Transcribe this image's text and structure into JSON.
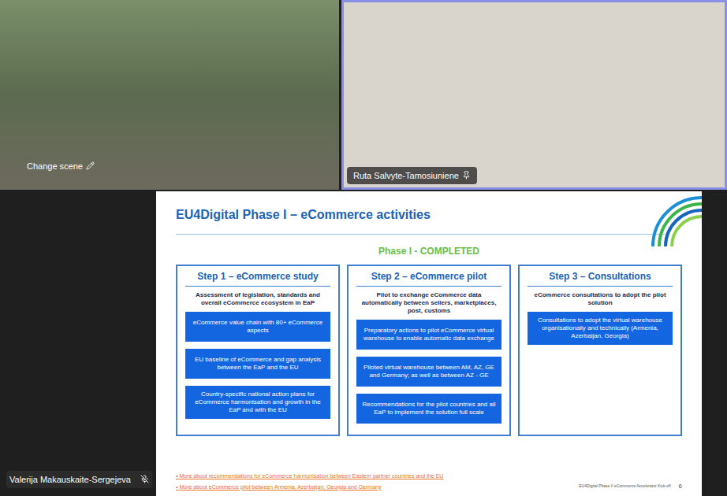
{
  "scene_tile": {
    "label": "Change scene"
  },
  "speaker_tile": {
    "name": "Ruta Salvyte-Tamosiuniene",
    "pinned": true,
    "selected": true
  },
  "presenter": {
    "name": "Valerija Makauskaite-Sergejeva",
    "muted": true
  },
  "slide": {
    "title": "EU4Digital Phase I – eCommerce activities",
    "status": "Phase I - COMPLETED",
    "steps": [
      {
        "title": "Step 1 – eCommerce study",
        "subtitle": "Assessment of legislation, standards and overall eCommerce ecosystem in EaP",
        "items": [
          "eCommerce value chain with 80+ eCommerce aspects",
          "EU baseline of eCommerce and gap analysis between the EaP and the EU",
          "Country-specific national action plans for eCommerce harmonisation and growth in the EaP and with the EU"
        ]
      },
      {
        "title": "Step 2 – eCommerce pilot",
        "subtitle": "Pilot to exchange eCommerce data automatically between sellers, marketplaces, post, customs",
        "items": [
          "Preparatory actions to pilot eCommerce virtual warehouse to enable automatic data exchange",
          "Piloted virtual warehouse between AM, AZ, GE and Germany; as well as between AZ - GE",
          "Recommendations for the pilot countries and all EaP to implement the solution full scale"
        ]
      },
      {
        "title": "Step 3 – Consultations",
        "subtitle": "eCommerce consultations to adopt the pilot solution",
        "items": [
          "Consultations to adopt the virtual warehouse organisationally and technically (Armenia, Azerbaijan, Georgia)"
        ]
      }
    ],
    "links": [
      "More about recommendations for eCommerce harmonisation between Eastern partner countries and the EU",
      "More about eCommerce pilot between Armenia, Azerbaijan, Georgia and Germany"
    ],
    "footer": "EU4Digital Phase II eCommerce Accelerator Kick-off",
    "page": "6"
  }
}
